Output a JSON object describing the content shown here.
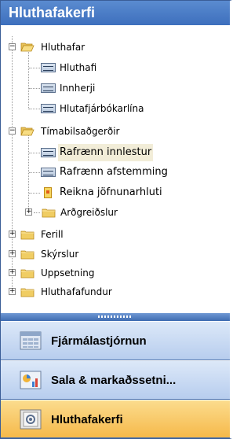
{
  "pane": {
    "title": "Hluthafakerfi"
  },
  "tree": {
    "hluthafar": "Hluthafar",
    "hluthafi": "Hluthafi",
    "innherji": "Innherji",
    "hlutafjarbokarlina": "Hlutafjárbókarlína",
    "timabilsadgerdir": "Tímabilsaðgerðir",
    "rafraenn_innlestur": "Rafrænn innlestur",
    "rafraenn_afstemming": "Rafrænn afstemming",
    "reikna_jofnunarhluti": "Reikna jöfnunarhluti",
    "aragreidslur": "Arðgreiðslur",
    "ferill": "Ferill",
    "skyrslur": "Skýrslur",
    "uppsetning": "Uppsetning",
    "hluthafafundur": "Hluthafafundur"
  },
  "nav": {
    "fjarmalastjornun": "Fjármálastjórnun",
    "sala": "Sala & markaðssetni...",
    "hluthafakerfi": "Hluthafakerfi"
  },
  "colors": {
    "header": "#3d6fbd",
    "selected": "#f2edd8",
    "active_nav": "#f6b94a",
    "nav": "#c7d9f2"
  }
}
